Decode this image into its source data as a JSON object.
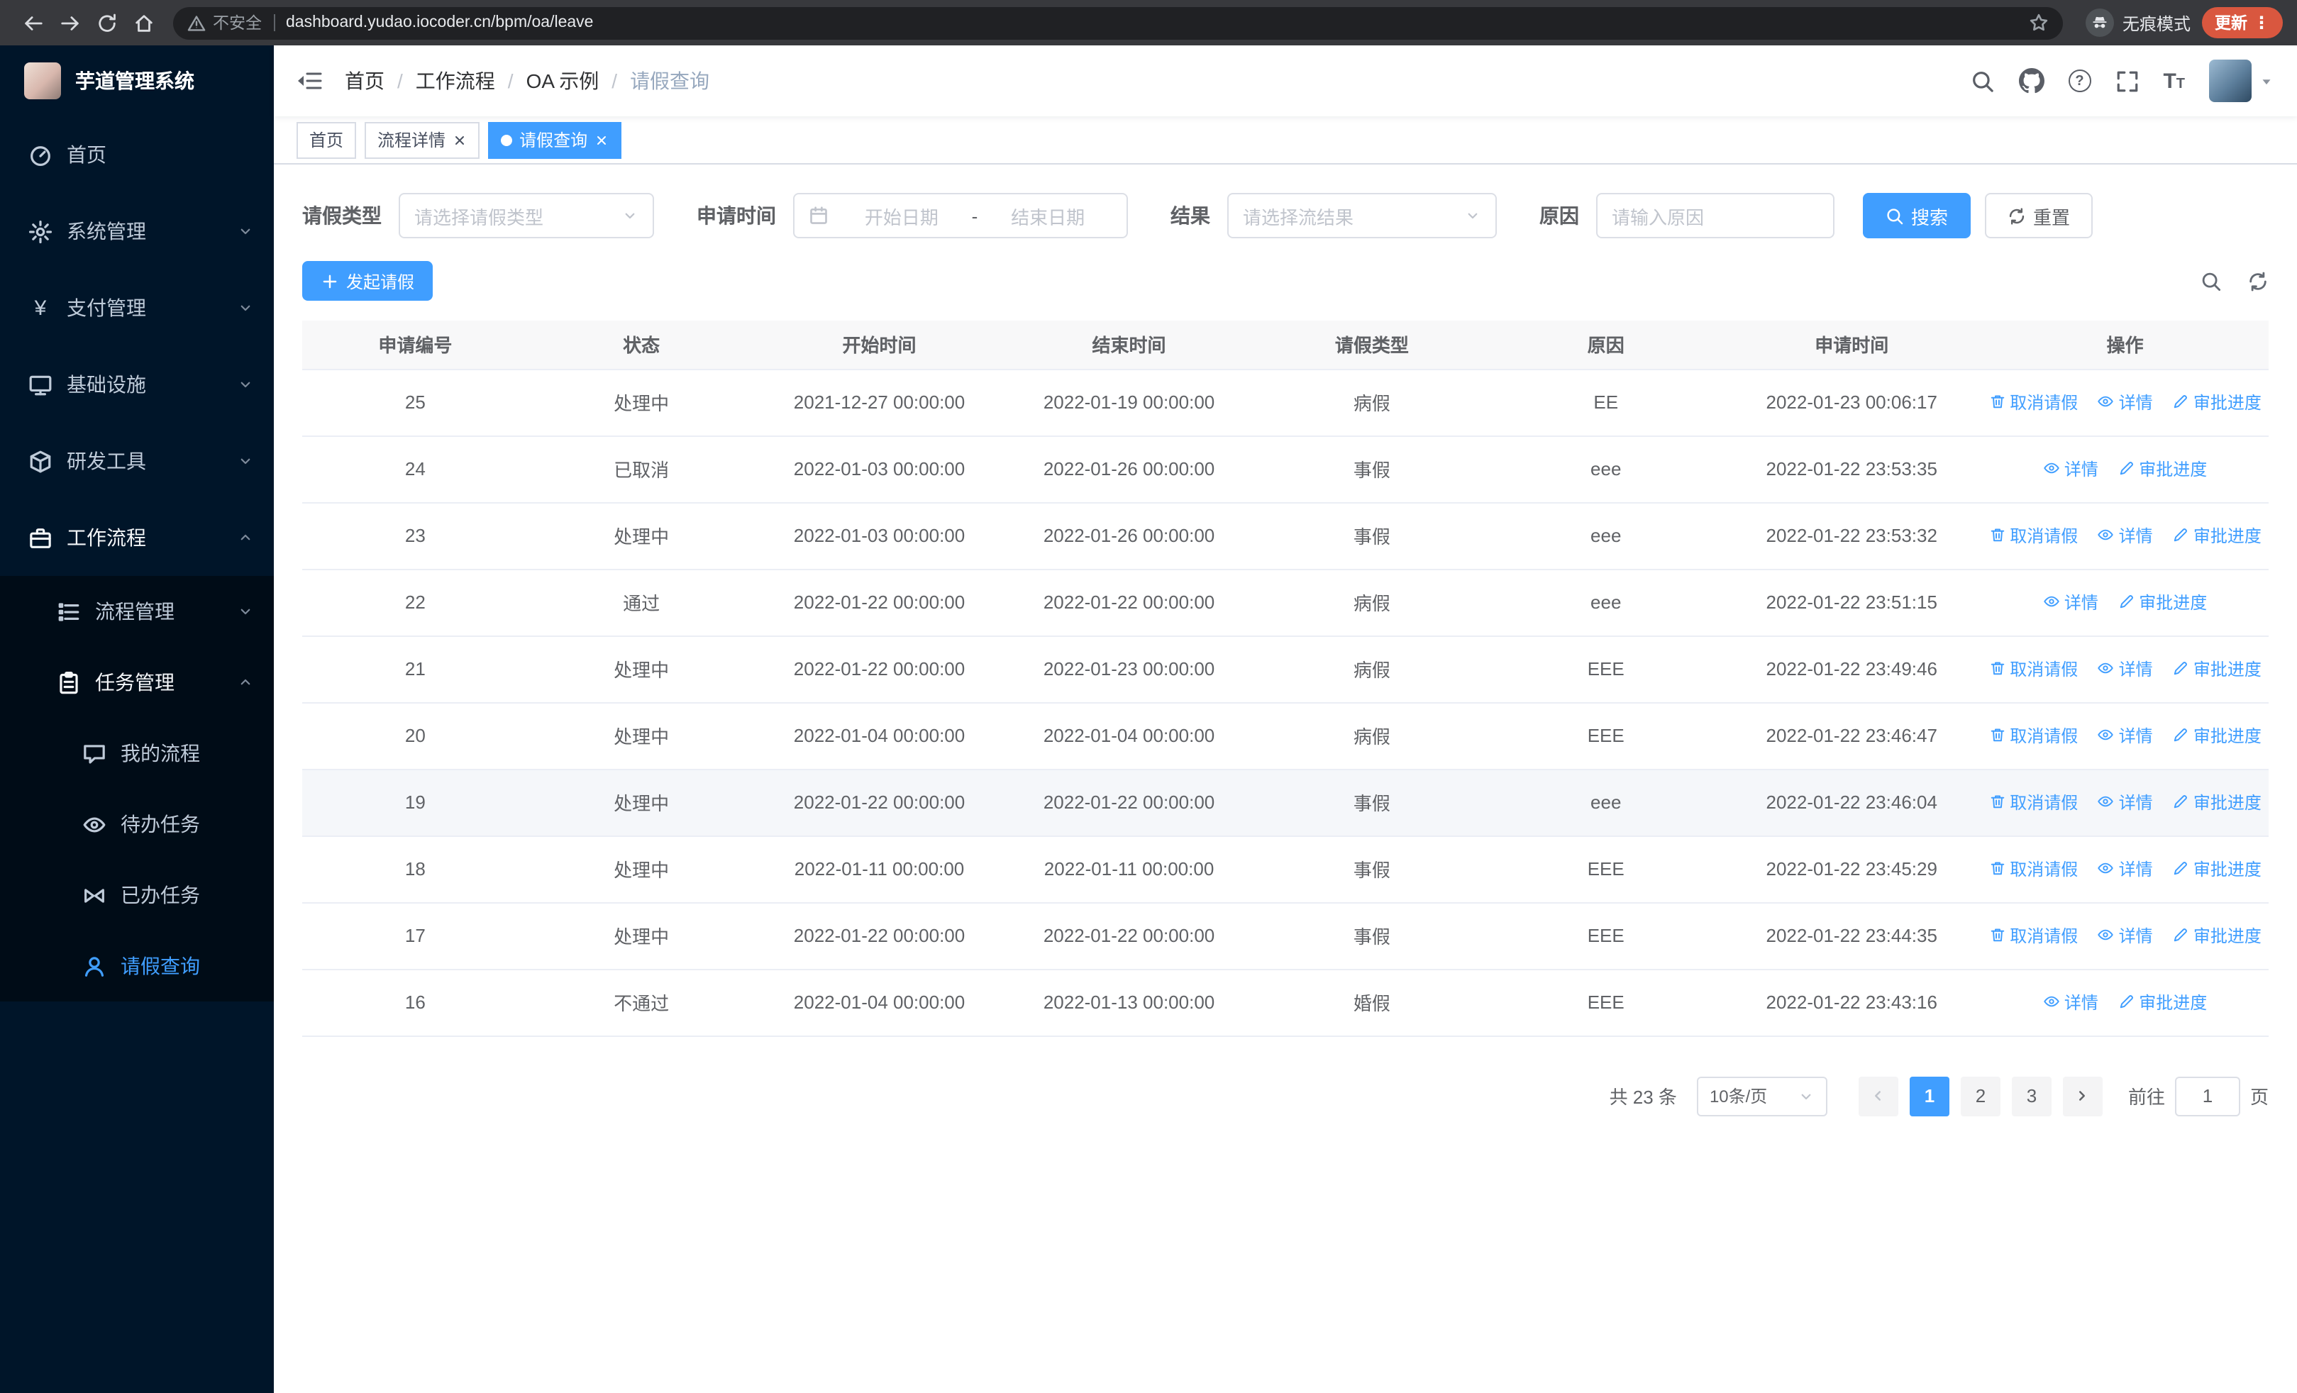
{
  "browser": {
    "security_label": "不安全",
    "url": "dashboard.yudao.iocoder.cn/bpm/oa/leave",
    "incognito_label": "无痕模式",
    "update_label": "更新"
  },
  "icons": {
    "yen_glyph": "¥",
    "help_glyph": "?",
    "font_size_glyph": "T",
    "more_glyph": "⋮"
  },
  "sidebar": {
    "logo_title": "芋道管理系统",
    "items": [
      {
        "label": "首页"
      },
      {
        "label": "系统管理"
      },
      {
        "label": "支付管理"
      },
      {
        "label": "基础设施"
      },
      {
        "label": "研发工具"
      },
      {
        "label": "工作流程"
      },
      {
        "label": "流程管理"
      },
      {
        "label": "任务管理"
      },
      {
        "label": "我的流程"
      },
      {
        "label": "待办任务"
      },
      {
        "label": "已办任务"
      },
      {
        "label": "请假查询"
      }
    ]
  },
  "header": {
    "breadcrumb": [
      "首页",
      "工作流程",
      "OA 示例",
      "请假查询"
    ],
    "breadcrumb_separator": "/"
  },
  "tabs": [
    {
      "label": "首页"
    },
    {
      "label": "流程详情",
      "closable": true
    },
    {
      "label": "请假查询",
      "closable": true,
      "active": true
    }
  ],
  "filters": {
    "leave_type_label": "请假类型",
    "leave_type_placeholder": "请选择请假类型",
    "apply_time_label": "申请时间",
    "start_date_placeholder": "开始日期",
    "range_separator": "-",
    "end_date_placeholder": "结束日期",
    "result_label": "结果",
    "result_placeholder": "请选择流结果",
    "reason_label": "原因",
    "reason_placeholder": "请输入原因",
    "search_button": "搜索",
    "reset_button": "重置"
  },
  "toolbar": {
    "create_button": "发起请假"
  },
  "table": {
    "columns": [
      "申请编号",
      "状态",
      "开始时间",
      "结束时间",
      "请假类型",
      "原因",
      "申请时间",
      "操作"
    ],
    "action_labels": {
      "cancel": "取消请假",
      "detail": "详情",
      "progress": "审批进度"
    },
    "rows": [
      {
        "id": "25",
        "status": "处理中",
        "start": "2021-12-27 00:00:00",
        "end": "2022-01-19 00:00:00",
        "type": "病假",
        "reason": "EE",
        "applied": "2022-01-23 00:06:17",
        "actions": [
          "cancel",
          "detail",
          "progress"
        ]
      },
      {
        "id": "24",
        "status": "已取消",
        "start": "2022-01-03 00:00:00",
        "end": "2022-01-26 00:00:00",
        "type": "事假",
        "reason": "eee",
        "applied": "2022-01-22 23:53:35",
        "actions": [
          "detail",
          "progress"
        ]
      },
      {
        "id": "23",
        "status": "处理中",
        "start": "2022-01-03 00:00:00",
        "end": "2022-01-26 00:00:00",
        "type": "事假",
        "reason": "eee",
        "applied": "2022-01-22 23:53:32",
        "actions": [
          "cancel",
          "detail",
          "progress"
        ]
      },
      {
        "id": "22",
        "status": "通过",
        "start": "2022-01-22 00:00:00",
        "end": "2022-01-22 00:00:00",
        "type": "病假",
        "reason": "eee",
        "applied": "2022-01-22 23:51:15",
        "actions": [
          "detail",
          "progress"
        ]
      },
      {
        "id": "21",
        "status": "处理中",
        "start": "2022-01-22 00:00:00",
        "end": "2022-01-23 00:00:00",
        "type": "病假",
        "reason": "EEE",
        "applied": "2022-01-22 23:49:46",
        "actions": [
          "cancel",
          "detail",
          "progress"
        ]
      },
      {
        "id": "20",
        "status": "处理中",
        "start": "2022-01-04 00:00:00",
        "end": "2022-01-04 00:00:00",
        "type": "病假",
        "reason": "EEE",
        "applied": "2022-01-22 23:46:47",
        "actions": [
          "cancel",
          "detail",
          "progress"
        ]
      },
      {
        "id": "19",
        "status": "处理中",
        "start": "2022-01-22 00:00:00",
        "end": "2022-01-22 00:00:00",
        "type": "事假",
        "reason": "eee",
        "applied": "2022-01-22 23:46:04",
        "actions": [
          "cancel",
          "detail",
          "progress"
        ],
        "highlighted": true
      },
      {
        "id": "18",
        "status": "处理中",
        "start": "2022-01-11 00:00:00",
        "end": "2022-01-11 00:00:00",
        "type": "事假",
        "reason": "EEE",
        "applied": "2022-01-22 23:45:29",
        "actions": [
          "cancel",
          "detail",
          "progress"
        ]
      },
      {
        "id": "17",
        "status": "处理中",
        "start": "2022-01-22 00:00:00",
        "end": "2022-01-22 00:00:00",
        "type": "事假",
        "reason": "EEE",
        "applied": "2022-01-22 23:44:35",
        "actions": [
          "cancel",
          "detail",
          "progress"
        ]
      },
      {
        "id": "16",
        "status": "不通过",
        "start": "2022-01-04 00:00:00",
        "end": "2022-01-13 00:00:00",
        "type": "婚假",
        "reason": "EEE",
        "applied": "2022-01-22 23:43:16",
        "actions": [
          "detail",
          "progress"
        ]
      }
    ]
  },
  "pagination": {
    "total_text": "共 23 条",
    "page_size": "10条/页",
    "pages": [
      "1",
      "2",
      "3"
    ],
    "active_page": "1",
    "goto_label": "前往",
    "goto_value": "1",
    "goto_suffix": "页"
  },
  "colors": {
    "primary": "#409eff",
    "sidebar_bg": "#001529",
    "submenu_bg": "#000c17"
  }
}
